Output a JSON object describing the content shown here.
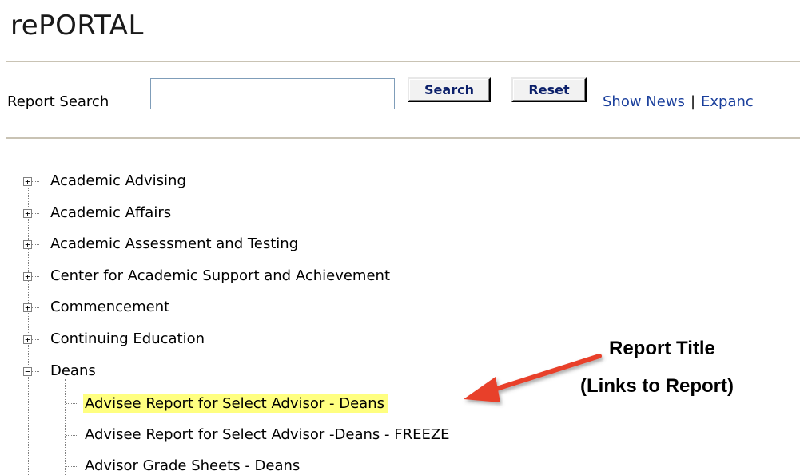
{
  "app": {
    "title": "rePORTAL"
  },
  "search": {
    "label": "Report Search",
    "value": "",
    "placeholder": "",
    "search_button": "Search",
    "reset_button": "Reset"
  },
  "header_links": {
    "show_news": "Show News",
    "separator": "|",
    "expand": "Expanc"
  },
  "tree": {
    "categories": [
      {
        "label": "Academic Advising",
        "expanded": false
      },
      {
        "label": "Academic Affairs",
        "expanded": false
      },
      {
        "label": "Academic Assessment and Testing",
        "expanded": false
      },
      {
        "label": "Center for Academic Support and Achievement",
        "expanded": false
      },
      {
        "label": "Commencement",
        "expanded": false
      },
      {
        "label": "Continuing Education",
        "expanded": false
      },
      {
        "label": "Deans",
        "expanded": true
      }
    ],
    "deans_reports": [
      {
        "label": "Advisee Report for Select Advisor - Deans",
        "highlighted": true
      },
      {
        "label": "Advisee Report for Select Advisor -Deans - FREEZE",
        "highlighted": false
      },
      {
        "label": "Advisor Grade Sheets - Deans",
        "highlighted": false
      }
    ]
  },
  "annotation": {
    "line1": "Report Title",
    "line2": "(Links to Report)",
    "arrow_color": "#e8402a",
    "highlight_color": "#ffff80"
  },
  "icons": {
    "collapsed": "plus-box-icon",
    "expanded": "minus-box-icon"
  }
}
